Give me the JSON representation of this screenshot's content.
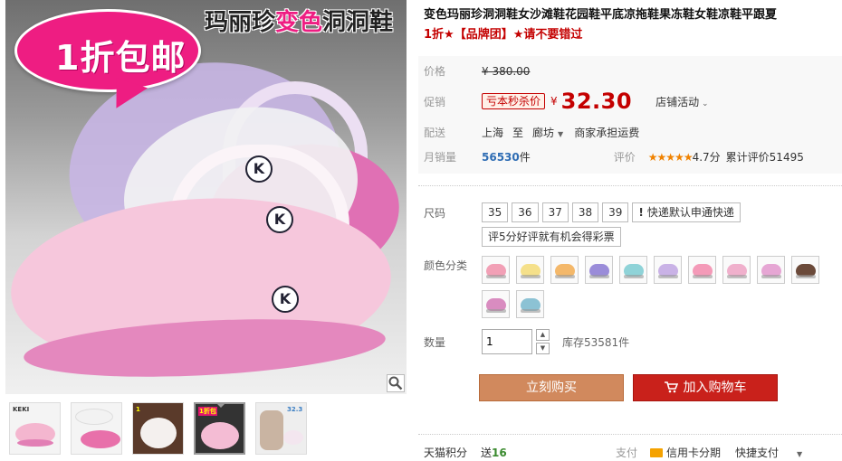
{
  "gallery": {
    "promo_badge": "1折包邮",
    "brand_banner_pre": "玛丽珍",
    "brand_banner_highlight": "变色",
    "brand_banner_post": "洞洞鞋",
    "logo_letter": "K",
    "thumbs": [
      {
        "label": "KEKI"
      },
      {
        "label": ""
      },
      {
        "label": "1"
      },
      {
        "label": "1折包"
      },
      {
        "label": "32.3"
      }
    ]
  },
  "product": {
    "title": "变色玛丽珍洞洞鞋女沙滩鞋花园鞋平底凉拖鞋果冻鞋女鞋凉鞋平跟夏",
    "subtitle": "1折★【品牌团】★请不要错过"
  },
  "price": {
    "label": "价格",
    "original": "¥ 380.00"
  },
  "promotion": {
    "label": "促销",
    "tag": "亏本秒杀价",
    "currency": "¥",
    "price": "32.30",
    "shop_activity": "店铺活动"
  },
  "shipping": {
    "label": "配送",
    "from": "上海",
    "to_word": "至",
    "destination": "廊坊",
    "fee_note": "商家承担运费"
  },
  "sales": {
    "label": "月销量",
    "count": "56530",
    "unit": "件",
    "rating_label": "评价",
    "stars": "★★★★★",
    "score": "4.7分",
    "review_count": "累计评价51495"
  },
  "size": {
    "label": "尺码",
    "options": [
      "35",
      "36",
      "37",
      "38",
      "39"
    ],
    "express_option": "快递默认申通快递",
    "extra_option": "评5分好评就有机会得彩票"
  },
  "colors": {
    "label": "颜色分类",
    "swatches": [
      "#f2a0b6",
      "#f5e08a",
      "#f4b86a",
      "#9a8cd9",
      "#8fd3d8",
      "#c9b2e6",
      "#f49ab8",
      "#f0b0cc",
      "#e6a6d4",
      "#6b4a3a",
      "#d98cc0",
      "#8cc2d4"
    ]
  },
  "quantity": {
    "label": "数量",
    "value": "1",
    "stock": "库存53581件"
  },
  "actions": {
    "buy_now": "立刻购买",
    "add_to_cart": "加入购物车"
  },
  "footer": {
    "points_label": "天猫积分",
    "points_prefix": "送",
    "points_value": "16",
    "pay_label": "支付",
    "credit_card": "信用卡分期",
    "quick_pay": "快捷支付"
  },
  "colors_theme": {
    "accent_red": "#c40000",
    "buy_orange": "#d1895d",
    "cart_red": "#c9211b"
  }
}
